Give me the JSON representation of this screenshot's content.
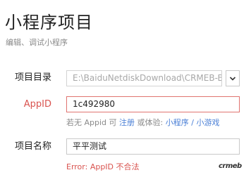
{
  "header": {
    "title": "小程序项目",
    "subtitle": "编辑、调试小程序"
  },
  "form": {
    "directory": {
      "label": "项目目录",
      "value": "E:\\BaiduNetdiskDownload\\CRMEB-B"
    },
    "appid": {
      "label": "AppID",
      "value": "1c492980"
    },
    "hint": {
      "prefix": "若无 Appid 可",
      "register": "注册",
      "or_try": "或体验:",
      "miniprogram": "小程序",
      "separator": "/",
      "minigame": "小游戏"
    },
    "project_name": {
      "label": "项目名称",
      "value": "平平测试"
    },
    "error": "Error: AppID 不合法"
  },
  "brand": {
    "logo_text": "crmeb"
  },
  "colors": {
    "error": "#d9534f",
    "link": "#4a7fd6",
    "muted": "#8a8a8a"
  }
}
